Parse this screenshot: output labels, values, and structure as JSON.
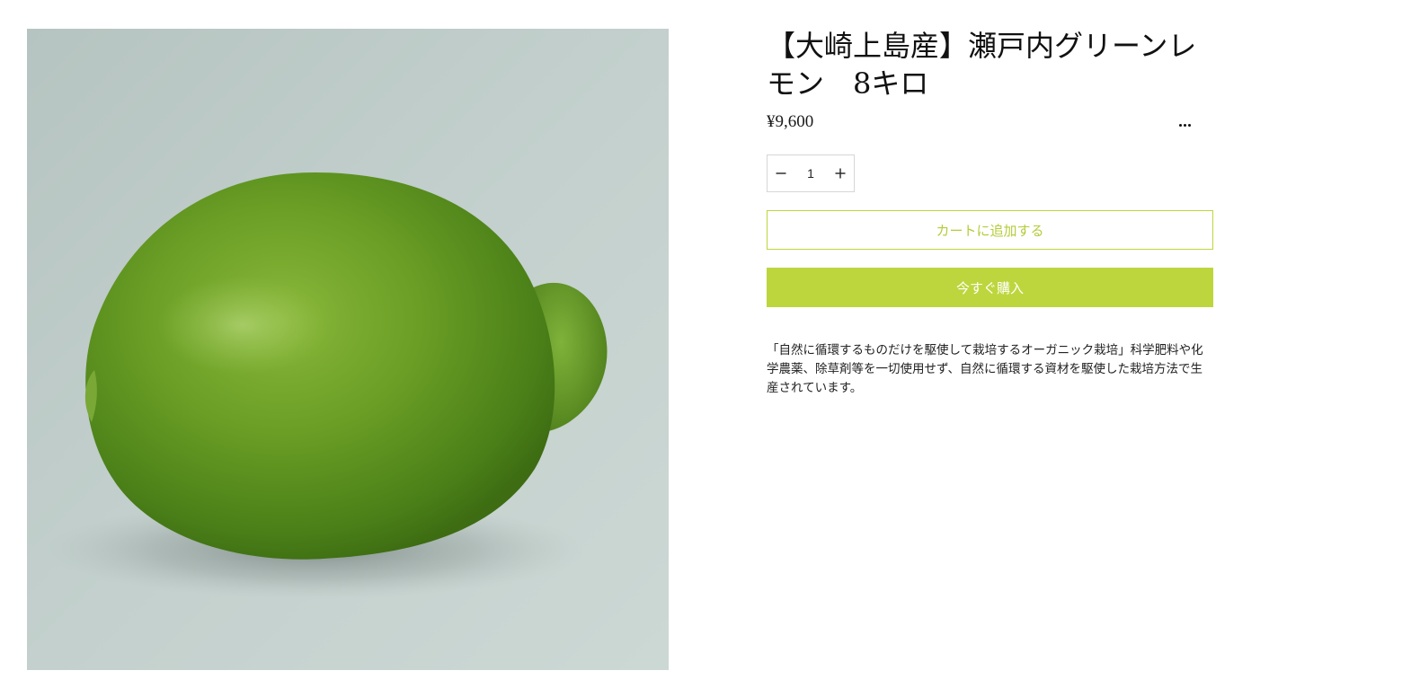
{
  "product": {
    "title": "【大崎上島産】瀬戸内グリーンレモン　8キロ",
    "price": "¥9,600",
    "image_alt": "瀬戸内グリーンレモン",
    "description": "「自然に循環するものだけを駆使して栽培するオーガニック栽培」科学肥料や化学農薬、除草剤等を一切使用せず、自然に循環する資材を駆使した栽培方法で生産されています。"
  },
  "quantity": {
    "value": "1",
    "decrement_icon": "minus-icon",
    "increment_icon": "plus-icon"
  },
  "actions": {
    "add_to_cart": "カートに追加する",
    "buy_now": "今すぐ購入",
    "more_icon": "more-dots-icon"
  },
  "colors": {
    "accent": "#bdd63d",
    "accent_text": "#b4cc3a",
    "text": "#1a1a1a"
  }
}
